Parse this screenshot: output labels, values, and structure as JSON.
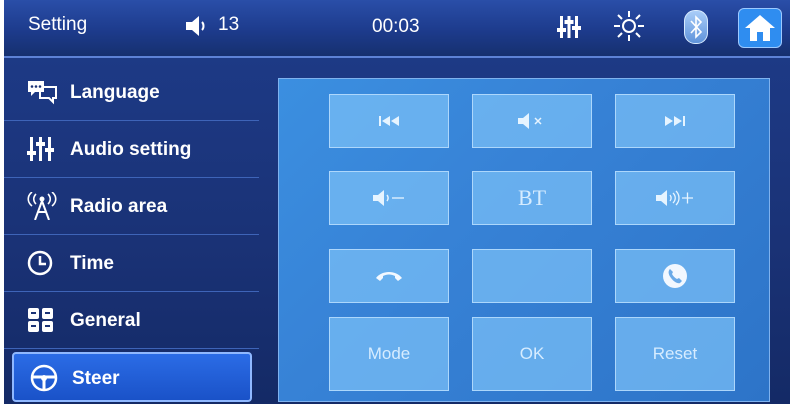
{
  "header": {
    "title": "Setting",
    "volume_value": "13",
    "clock": "00:03",
    "icons": [
      "speaker-icon",
      "equalizer-icon",
      "brightness-icon",
      "bluetooth-icon",
      "home-icon"
    ]
  },
  "sidebar": {
    "items": [
      {
        "label": "Language",
        "icon": "speech-bubbles-icon"
      },
      {
        "label": "Audio setting",
        "icon": "equalizer-icon"
      },
      {
        "label": "Radio area",
        "icon": "antenna-icon"
      },
      {
        "label": "Time",
        "icon": "clock-icon"
      },
      {
        "label": "General",
        "icon": "grid-icon"
      },
      {
        "label": "Steer",
        "icon": "steering-wheel-icon"
      }
    ],
    "active": "Steer"
  },
  "steer_keys": {
    "prev": {
      "icon": "skip-previous-icon"
    },
    "mute": {
      "icon": "mute-icon"
    },
    "next": {
      "icon": "skip-next-icon"
    },
    "vol_down": {
      "icon": "volume-down-icon"
    },
    "bt": {
      "label": "BT"
    },
    "vol_up": {
      "icon": "volume-up-icon"
    },
    "hang_up": {
      "icon": "hang-up-icon"
    },
    "blank": {
      "label": ""
    },
    "answer": {
      "icon": "phone-answer-icon"
    },
    "mode": {
      "label": "Mode"
    },
    "ok": {
      "label": "OK"
    },
    "reset": {
      "label": "Reset"
    }
  },
  "colors": {
    "screen_bg": "#1a3276",
    "panel_bg": "#3782d6",
    "key_bg": "#78bef5",
    "active_item": "#2b6ce6",
    "home_button": "#2f8df0"
  }
}
